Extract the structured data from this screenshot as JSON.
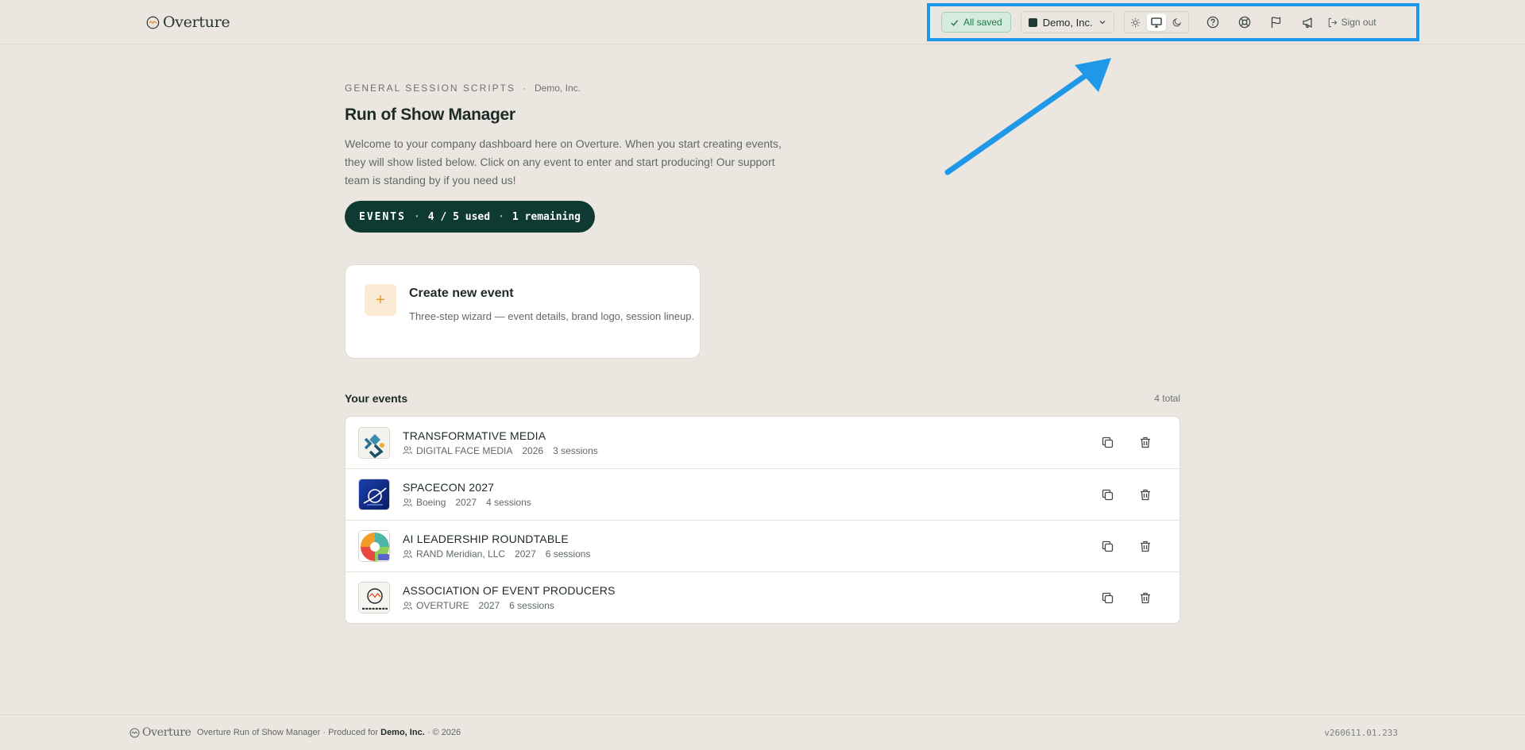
{
  "app": {
    "brand_name": "Overture"
  },
  "toolbar": {
    "saved_label": "All saved",
    "org_name": "Demo, Inc.",
    "signout_label": "Sign out",
    "theme_active": "system"
  },
  "header": {
    "eyebrow": "GENERAL SESSION SCRIPTS",
    "eyebrow_sep": "·",
    "eyebrow_org": "Demo, Inc.",
    "title": "Run of Show Manager",
    "intro": "Welcome to your company dashboard here on Overture. When you start creating events, they will show listed below. Click on any event to enter and start producing! Our support team is standing by if you need us!"
  },
  "usage": {
    "label": "EVENTS",
    "sep": "·",
    "used": "4 / 5 used",
    "remaining": "1 remaining"
  },
  "create": {
    "title": "Create new event",
    "description": "Three-step wizard — event details, brand logo, session lineup."
  },
  "events": {
    "title": "Your events",
    "count": "4 total",
    "items": [
      {
        "name": "TRANSFORMATIVE MEDIA",
        "client": "DIGITAL FACE MEDIA",
        "year": "2026",
        "sessions": "3 sessions"
      },
      {
        "name": "SPACECON 2027",
        "client": "Boeing",
        "year": "2027",
        "sessions": "4 sessions"
      },
      {
        "name": "AI LEADERSHIP ROUNDTABLE",
        "client": "RAND Meridian, LLC",
        "year": "2027",
        "sessions": "6 sessions"
      },
      {
        "name": "ASSOCIATION OF EVENT PRODUCERS",
        "client": "OVERTURE",
        "year": "2027",
        "sessions": "6 sessions"
      }
    ]
  },
  "footer": {
    "brand_name": "Overture",
    "text_prefix": "Overture Run of Show Manager · Produced for",
    "org": "Demo, Inc.",
    "text_suffix": "· © 2026",
    "version": "v260611.01.233"
  },
  "colors": {
    "background": "#ebe7e0",
    "accent_dark": "#0f3a32",
    "saved_green": "#237a4f",
    "highlight_blue": "#1f98e8",
    "plus_orange": "#e39a3a"
  }
}
